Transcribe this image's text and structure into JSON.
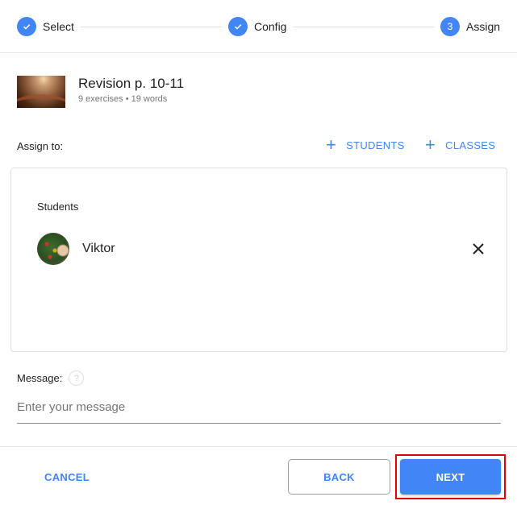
{
  "stepper": {
    "steps": [
      {
        "label": "Select",
        "state": "done",
        "icon": "check-icon"
      },
      {
        "label": "Config",
        "state": "done",
        "icon": "check-icon"
      },
      {
        "label": "Assign",
        "state": "current",
        "number": "3"
      }
    ]
  },
  "lesson": {
    "title": "Revision p. 10-11",
    "subtitle": "9 exercises • 19 words"
  },
  "assign": {
    "label": "Assign to:",
    "add_students": "STUDENTS",
    "add_classes": "CLASSES"
  },
  "students": {
    "section_title": "Students",
    "items": [
      {
        "name": "Viktor"
      }
    ]
  },
  "message": {
    "label": "Message:",
    "placeholder": "Enter your message",
    "value": ""
  },
  "footer": {
    "cancel": "CANCEL",
    "back": "BACK",
    "next": "NEXT"
  },
  "colors": {
    "accent": "#4285f4",
    "highlight": "#e00000"
  }
}
